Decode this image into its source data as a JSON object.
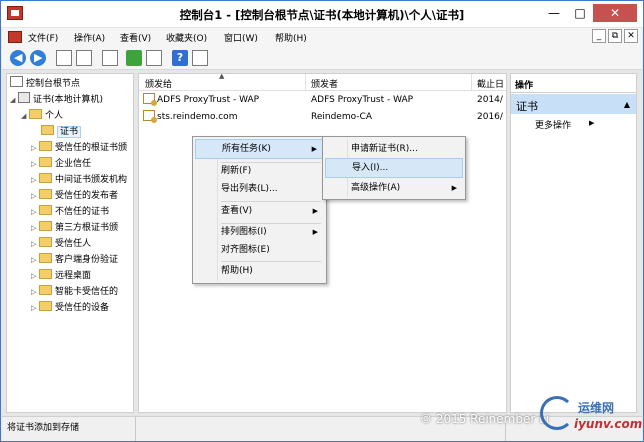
{
  "window": {
    "title": "控制台1 - [控制台根节点\\证书(本地计算机)\\个人\\证书]",
    "min_glyph": "—",
    "max_glyph": "□",
    "close_glyph": "✕"
  },
  "menubar": {
    "items": [
      "文件(F)",
      "操作(A)",
      "查看(V)",
      "收藏夹(O)",
      "窗口(W)",
      "帮助(H)"
    ],
    "inner_buttons": [
      "_",
      "⧉",
      "✕"
    ]
  },
  "toolbar": {
    "help_label": "?"
  },
  "tree": {
    "root": "控制台根节点",
    "store": "证书(本地计算机)",
    "personal": "个人",
    "certs": "证书",
    "folders": [
      "受信任的根证书颁",
      "企业信任",
      "中间证书颁发机构",
      "受信任的发布者",
      "不信任的证书",
      "第三方根证书颁",
      "受信任人",
      "客户端身份验证",
      "远程桌面",
      "智能卡受信任的",
      "受信任的设备"
    ]
  },
  "list": {
    "columns": [
      "颁发给",
      "颁发者",
      "截止日"
    ],
    "rows": [
      {
        "issued_to": "ADFS ProxyTrust - WAP",
        "issued_by": "ADFS ProxyTrust - WAP",
        "expires": "2014/"
      },
      {
        "issued_to": "sts.reindemo.com",
        "issued_by": "Reindemo-CA",
        "expires": "2016/"
      }
    ]
  },
  "actions": {
    "title": "操作",
    "section": "证书",
    "more": "更多操作"
  },
  "context_menu": {
    "items": [
      "所有任务(K)",
      "刷新(F)",
      "导出列表(L)...",
      "查看(V)",
      "排列图标(I)",
      "对齐图标(E)",
      "帮助(H)"
    ],
    "submenu": [
      "申请新证书(R)...",
      "导入(I)...",
      "高级操作(A)"
    ]
  },
  "status": {
    "text": "将证书添加到存储"
  },
  "overlay": {
    "copyright": "© 2015 Reinember Li",
    "logo_cn": "运维网",
    "logo_site": "iyunv.com"
  }
}
